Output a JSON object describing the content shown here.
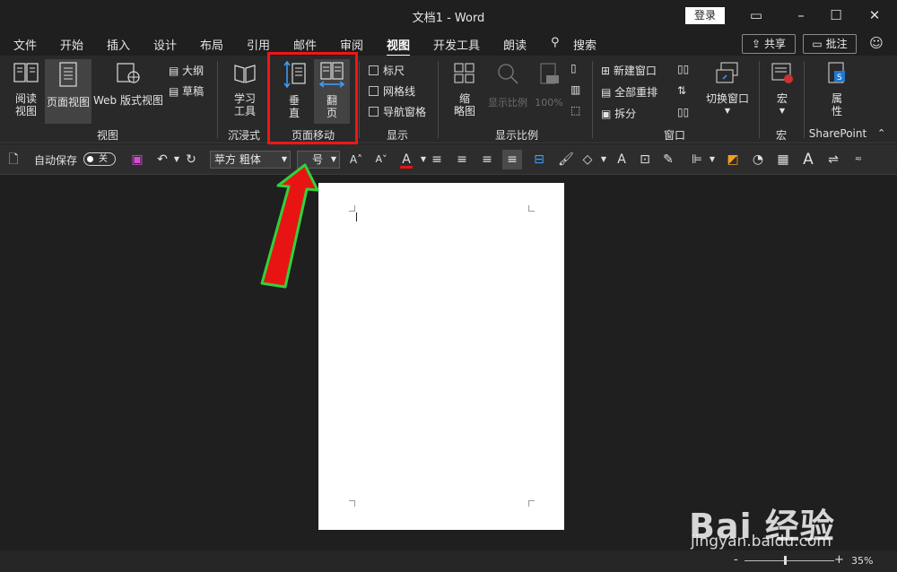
{
  "window": {
    "title": "文档1  -  Word",
    "login_label": "登录"
  },
  "menu": {
    "tabs": [
      "文件",
      "开始",
      "插入",
      "设计",
      "布局",
      "引用",
      "邮件",
      "审阅",
      "视图",
      "开发工具",
      "朗读"
    ],
    "search_label": "搜索",
    "share_label": "共享",
    "comment_label": "批注"
  },
  "ribbon": {
    "views": {
      "read_mode": "阅读\n视图",
      "print_layout": "页面视图",
      "web_layout": "Web 版式视图",
      "outline": "大纲",
      "draft": "草稿",
      "group": "视图"
    },
    "immersive": {
      "learning_tools": "学习\n工具",
      "group": "沉浸式"
    },
    "page_movement": {
      "vertical": "垂\n直",
      "side_to_side": "翻\n页",
      "group": "页面移动"
    },
    "show": {
      "ruler": "标尺",
      "gridlines": "网格线",
      "nav_pane": "导航窗格",
      "group": "显示"
    },
    "zoom": {
      "zoom": "缩\n略图",
      "zoom_disabled": "显示比例",
      "percent": "100%",
      "group": "显示比例"
    },
    "window": {
      "new_window": "新建窗口",
      "arrange_all": "全部重排",
      "split": "拆分",
      "switch_windows": "切换窗口",
      "group": "窗口"
    },
    "macros": {
      "macros": "宏",
      "group": "宏"
    },
    "sharepoint": {
      "properties": "属\n性",
      "group": "SharePoint"
    }
  },
  "qat": {
    "autosave_label": "自动保存",
    "autosave_state": "关",
    "font_name": "苹方 粗体",
    "font_size": "号"
  },
  "status": {
    "zoom_percent": "35%",
    "zoom_minus": "-",
    "zoom_plus": "+"
  },
  "watermark": {
    "brand": "Bai 经验",
    "site": "jingyan.baidu.com"
  },
  "colors": {
    "highlight_box": "#f01616",
    "arrow_fill": "#e81414",
    "arrow_outline": "#2fd23a",
    "font_color_bar": "#e81414"
  }
}
